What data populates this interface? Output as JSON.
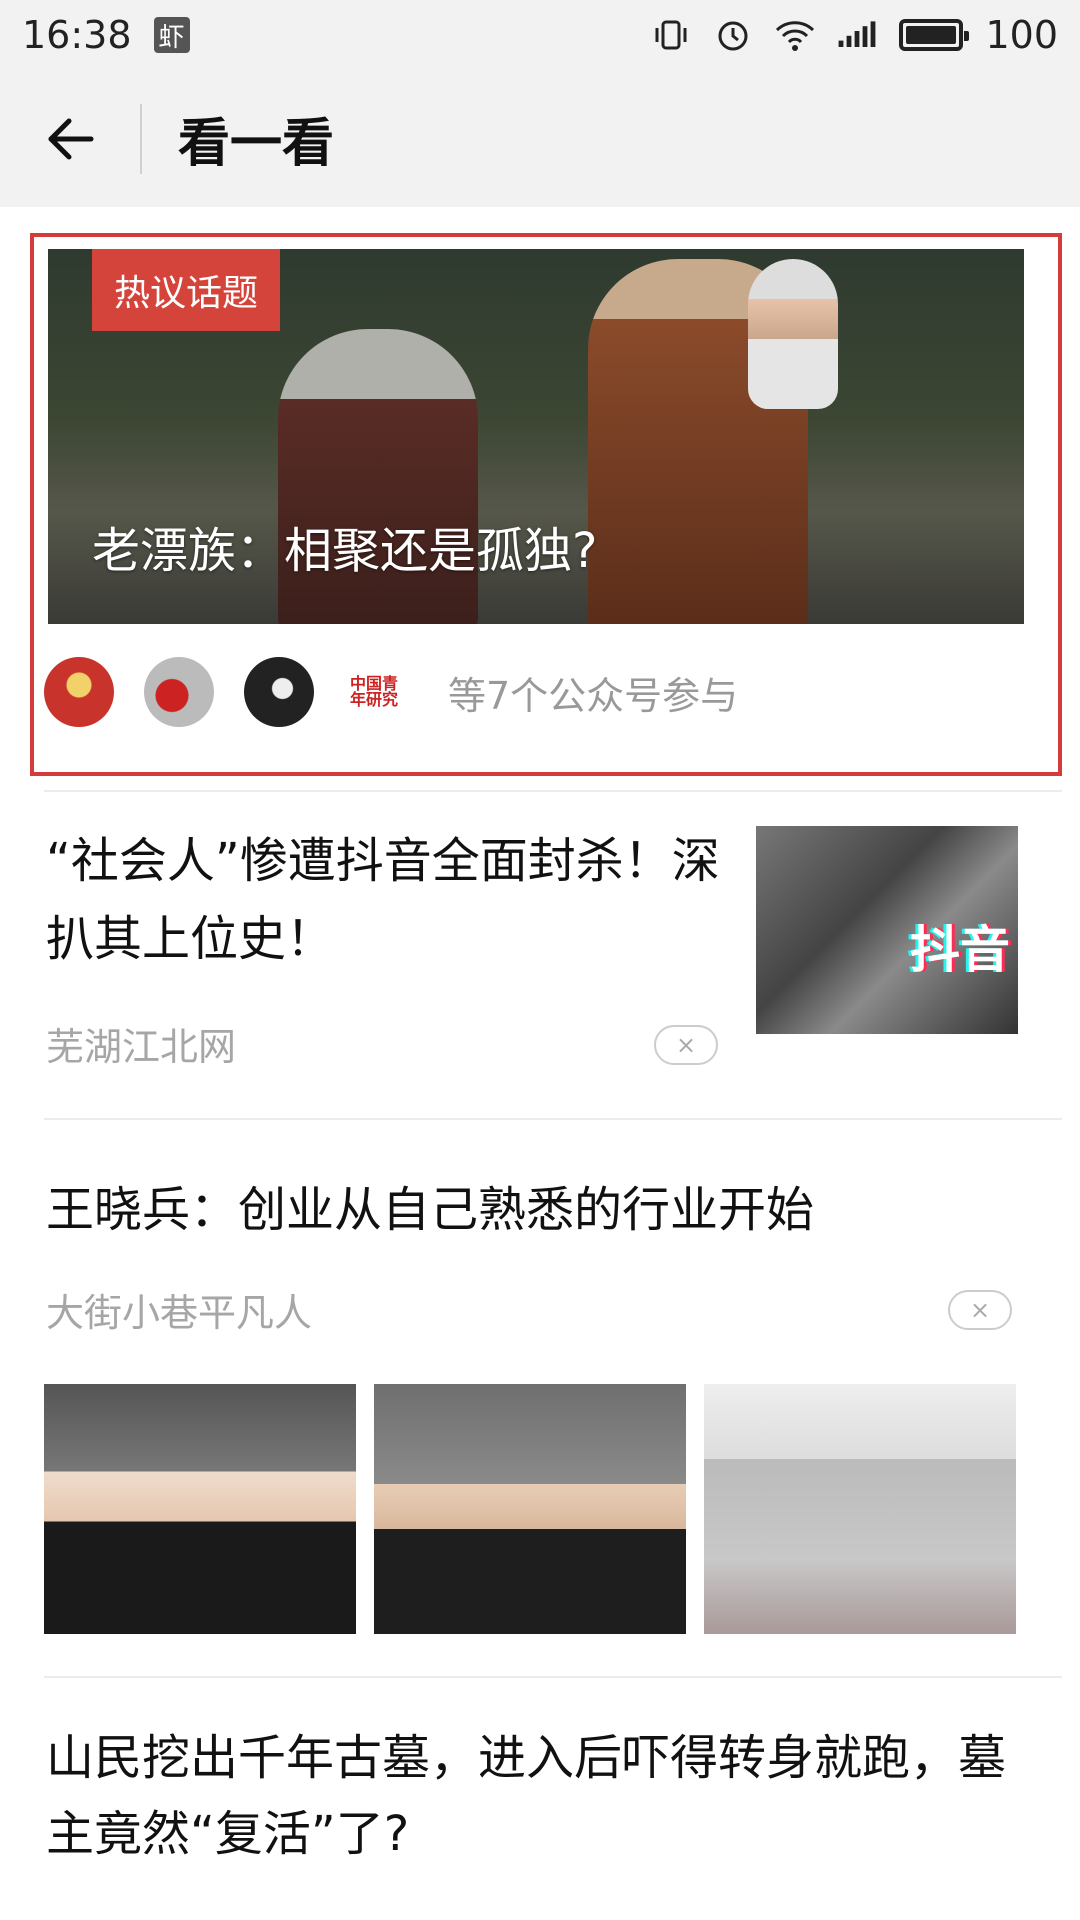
{
  "status_bar": {
    "time": "16:38",
    "app_badge": "虾",
    "battery": "100"
  },
  "nav": {
    "title": "看一看"
  },
  "topic": {
    "badge": "热议话题",
    "title": "老漂族：相聚还是孤独?",
    "participants": "等7个公众号参与",
    "avatar4_text": "中国青年研究"
  },
  "articles": [
    {
      "title": "“社会人”惨遭抖音全面封杀！深扒其上位史！",
      "source": "芜湖江北网",
      "thumb_text": "抖音"
    },
    {
      "title": "王晓兵：创业从自己熟悉的行业开始",
      "source": "大街小巷平凡人"
    },
    {
      "title": "山民挖出千年古墓，进入后吓得转身就跑，墓主竟然“复活”了?"
    }
  ],
  "close_symbol": "×"
}
